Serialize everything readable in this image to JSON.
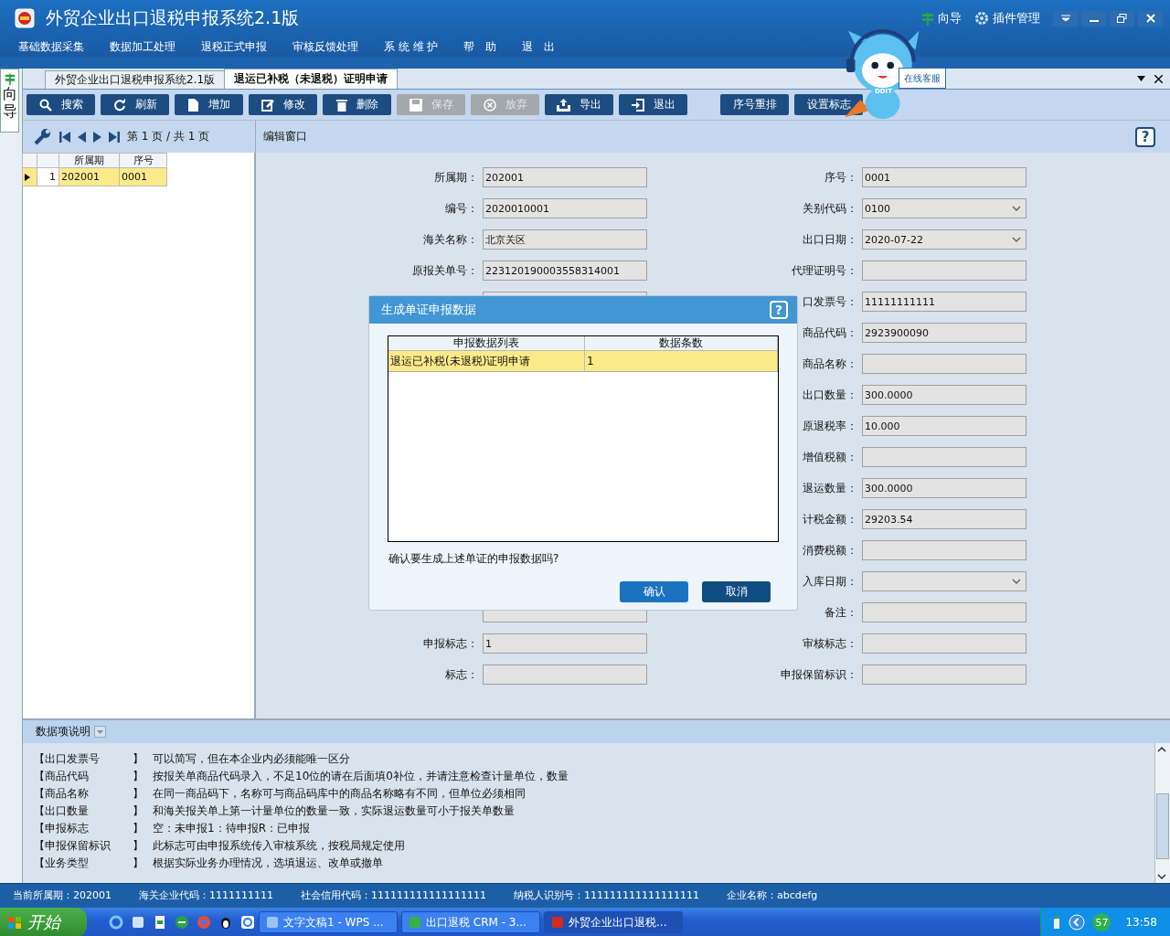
{
  "window": {
    "title": "外贸企业出口退税申报系统2.1版",
    "title_actions": [
      {
        "kind": "guide",
        "label": "向导"
      },
      {
        "kind": "plugin",
        "label": "插件管理"
      }
    ]
  },
  "menu": [
    "基础数据采集",
    "数据加工处理",
    "退税正式申报",
    "审核反馈处理",
    "系 统 维 护",
    "帮　助",
    "退　出"
  ],
  "mascot": {
    "badge": "在线客服",
    "label": "DDIT"
  },
  "side_tab": {
    "label": "向导"
  },
  "tabs": [
    {
      "label": "外贸企业出口退税申报系统2.1版",
      "selected": false
    },
    {
      "label": "退运已补税（未退税）证明申请",
      "selected": true
    }
  ],
  "toolbar": [
    {
      "kind": "search",
      "label": "搜索",
      "disabled": false
    },
    {
      "kind": "refresh",
      "label": "刷新",
      "disabled": false
    },
    {
      "kind": "add",
      "label": "增加",
      "disabled": false
    },
    {
      "kind": "edit",
      "label": "修改",
      "disabled": false
    },
    {
      "kind": "delete",
      "label": "删除",
      "disabled": false
    },
    {
      "kind": "save",
      "label": "保存",
      "disabled": true
    },
    {
      "kind": "cancel",
      "label": "放弃",
      "disabled": true
    },
    {
      "kind": "export",
      "label": "导出",
      "disabled": false
    },
    {
      "kind": "exit",
      "label": "退出",
      "disabled": false
    },
    {
      "kind": "plain",
      "label": "序号重排",
      "disabled": false
    },
    {
      "kind": "plain",
      "label": "设置标志",
      "disabled": false
    }
  ],
  "pager": {
    "text": "第 1 页 / 共 1 页"
  },
  "list": {
    "columns": [
      "所属期",
      "序号"
    ],
    "rows": [
      {
        "index": "1",
        "cells": [
          "202001",
          "0001"
        ],
        "selected": true
      }
    ]
  },
  "editor": {
    "title": "编辑窗口",
    "help_glyph": "?",
    "left_top_fields": [
      {
        "label": "所属期：",
        "value": "202001",
        "kind": "text"
      },
      {
        "label": "编号：",
        "value": "2020010001",
        "kind": "text"
      },
      {
        "label": "海关名称：",
        "value": "北京关区",
        "kind": "text"
      },
      {
        "label": "原报关单号：",
        "value": "223120190003558314001",
        "kind": "text"
      }
    ],
    "left_bottom_fields": [
      {
        "label": "申报标志：",
        "value": "1",
        "kind": "text"
      },
      {
        "label": "标志：",
        "kind": "text"
      }
    ],
    "right_fields": [
      {
        "label": "序号：",
        "value": "0001",
        "kind": "text"
      },
      {
        "label": "关别代码：",
        "value": "0100",
        "kind": "dropdown"
      },
      {
        "label": "出口日期：",
        "value": "2020-07-22",
        "kind": "dropdown"
      },
      {
        "label": "代理证明号：",
        "kind": "text"
      },
      {
        "label": "口发票号：",
        "value": "11111111111",
        "kind": "text"
      },
      {
        "label": "商品代码：",
        "value": "2923900090",
        "kind": "text"
      },
      {
        "label": "商品名称：",
        "kind": "text"
      },
      {
        "label": "出口数量：",
        "value": "300.0000",
        "kind": "text"
      },
      {
        "label": "原退税率：",
        "value": "10.000",
        "kind": "text"
      },
      {
        "label": "增值税额：",
        "kind": "text"
      },
      {
        "label": "退运数量：",
        "value": "300.0000",
        "kind": "text"
      },
      {
        "label": "计税金额：",
        "value": "29203.54",
        "kind": "text"
      },
      {
        "label": "消费税额：",
        "kind": "text"
      },
      {
        "label": "入库日期：",
        "kind": "dropdown"
      },
      {
        "label": "备注：",
        "kind": "text"
      },
      {
        "label": "审核标志：",
        "kind": "text"
      },
      {
        "label": "申报保留标识：",
        "kind": "text"
      }
    ]
  },
  "dialog": {
    "title": "生成单证申报数据",
    "help_glyph": "?",
    "columns": [
      "申报数据列表",
      "数据条数"
    ],
    "rows": [
      {
        "cells": [
          "退运已补税(未退税)证明申请",
          "1"
        ],
        "selected": true
      }
    ],
    "message": "确认要生成上述单证的申报数据吗?",
    "buttons": [
      {
        "label": "确认",
        "kind": "primary"
      },
      {
        "label": "取消",
        "kind": "secondary"
      }
    ]
  },
  "help": {
    "title": "数据项说明",
    "items": [
      {
        "name": "【出口发票号",
        "close": "】",
        "text": "可以简写，但在本企业内必须能唯一区分"
      },
      {
        "name": "【商品代码",
        "close": "】",
        "text": "按报关单商品代码录入，不足10位的请在后面填0补位，并请注意检查计量单位，数量"
      },
      {
        "name": "【商品名称",
        "close": "】",
        "text": "在同一商品码下，名称可与商品码库中的商品名称略有不同，但单位必须相同"
      },
      {
        "name": "【出口数量",
        "close": "】",
        "text": "和海关报关单上第一计量单位的数量一致，实际退运数量可小于报关单数量"
      },
      {
        "name": "【申报标志",
        "close": "】",
        "text": "空：未申报1：待申报R：已申报"
      },
      {
        "name": "【申报保留标识",
        "close": "】",
        "text": "此标志可由申报系统传入审核系统，按税局规定使用"
      },
      {
        "name": "【业务类型",
        "close": "】",
        "text": "根据实际业务办理情况，选填退运、改单或撤单"
      }
    ]
  },
  "status_bar": [
    "当前所属期：202001",
    "海关企业代码：1111111111",
    "社会信用代码：111111111111111111",
    "纳税人识别号：111111111111111111",
    "企业名称：abcdefg"
  ],
  "taskbar": {
    "start": "开始",
    "tasks": [
      {
        "label": "文字文稿1 - WPS ...",
        "selected": false
      },
      {
        "label": "出口退税 CRM - 3...",
        "selected": false
      },
      {
        "label": "外贸企业出口退税...",
        "selected": true
      }
    ],
    "badge": "57",
    "clock": "13:58"
  }
}
